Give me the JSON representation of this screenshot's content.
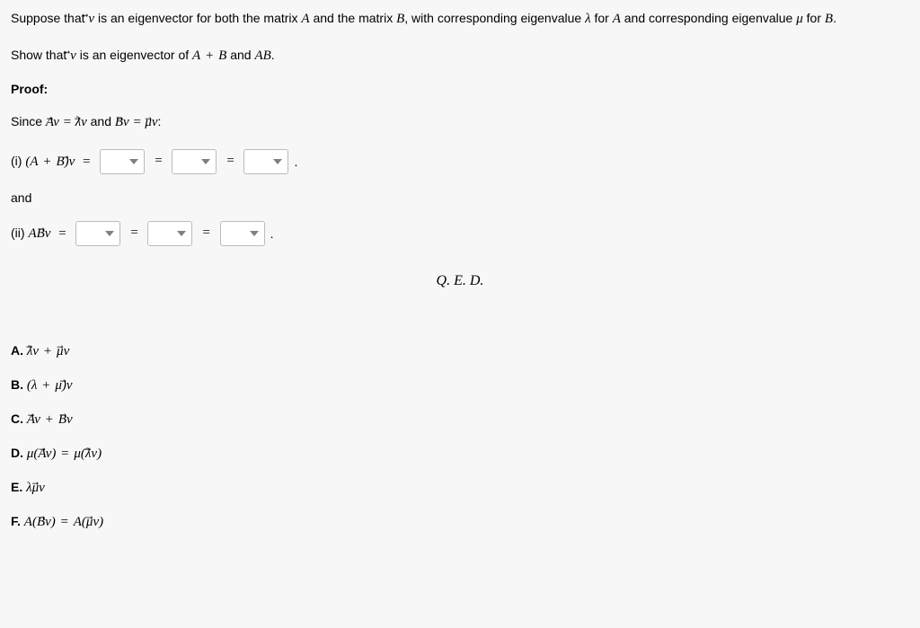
{
  "problem": {
    "line1_pre": "Suppose that ",
    "line1_vec": "v",
    "line1_mid1": " is an eigenvector for both the matrix ",
    "line1_A": "A",
    "line1_mid2": " and the matrix ",
    "line1_B": "B",
    "line1_mid3": ", with corresponding eigenvalue ",
    "line1_lambda": "λ",
    "line1_mid4": " for ",
    "line1_A2": "A",
    "line1_mid5": " and corresponding eigenvalue ",
    "line1_mu": "μ",
    "line1_mid6": " for ",
    "line1_B2": "B",
    "line1_end": "."
  },
  "show": {
    "pre": "Show that ",
    "vec": "v",
    "mid1": " is an eigenvector of ",
    "expr1": "A + B",
    "mid2": " and ",
    "expr2": "AB",
    "end": "."
  },
  "proof_label": "Proof:",
  "since": {
    "pre": "Since ",
    "av": "Av",
    "eq1": " = ",
    "lv": "λv",
    "and": " and ",
    "bv": "Bv",
    "eq2": " = ",
    "mv": "μv",
    "end": ":"
  },
  "part_i": {
    "label": "(i) ",
    "expr": "(A + B)v",
    "eq": " = "
  },
  "and_label": "and",
  "part_ii": {
    "label": "(ii) ",
    "expr": "ABv",
    "eq": " = "
  },
  "equals": "=",
  "period": ".",
  "qed": "Q. E. D.",
  "options": {
    "A": {
      "letter": "A.",
      "expr": "λv + μv"
    },
    "B": {
      "letter": "B.",
      "expr": "(λ + μ)v"
    },
    "C": {
      "letter": "C.",
      "expr": "Av + Bv"
    },
    "D": {
      "letter": "D.",
      "expr": "μ(Av) = μ(λv)"
    },
    "E": {
      "letter": "E.",
      "expr": "λμv"
    },
    "F": {
      "letter": "F.",
      "expr": "A(Bv) = A(μv)"
    }
  }
}
